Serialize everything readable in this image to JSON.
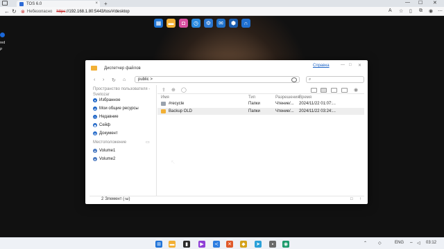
{
  "browser": {
    "tab_title": "TOS 6.0",
    "tab_close": "×",
    "new_tab": "+",
    "minimize": "—",
    "maximize": "☐",
    "close": "✕",
    "back": "←",
    "reload": "↻",
    "insecure_label": "Небезопасно",
    "url_proto": "https",
    "url_rest": "://192.168.1.80:5443/tos/#/desktop"
  },
  "desktop": {
    "left_labels": [
      "red",
      "P"
    ],
    "dock_icons": [
      {
        "name": "app-center-icon",
        "color": "#1e73d2",
        "glyph": "▦"
      },
      {
        "name": "file-manager-icon",
        "color": "#f2b035",
        "glyph": "▬"
      },
      {
        "name": "picture-icon",
        "color": "#d94fa0",
        "glyph": "◘"
      },
      {
        "name": "clock-icon",
        "color": "#2a8be0",
        "glyph": "◷"
      },
      {
        "name": "settings-icon",
        "color": "#2b77d0",
        "glyph": "⚙"
      },
      {
        "name": "mail-icon",
        "color": "#1f70c8",
        "glyph": "✉"
      },
      {
        "name": "box-icon",
        "color": "#1a5db0",
        "glyph": "⬢"
      },
      {
        "name": "headset-icon",
        "color": "#1f6fd0",
        "glyph": "∩"
      }
    ]
  },
  "file_manager": {
    "title": "Диспетчер файлов",
    "help_link": "Справка",
    "path": "public >",
    "sidebar": {
      "storage_heading": "Пространство пользователя - Svetozar",
      "items": [
        {
          "label": "Избранное",
          "icon": "heart-icon"
        },
        {
          "label": "Мои общие ресурсы",
          "icon": "share-icon"
        },
        {
          "label": "Недавние",
          "icon": "clock-icon"
        },
        {
          "label": "Сейф",
          "icon": "safe-icon"
        },
        {
          "label": "Документ",
          "icon": "document-icon"
        }
      ],
      "location_heading": "Местоположение",
      "volumes": [
        {
          "label": "Volume1",
          "icon": "disk-icon"
        },
        {
          "label": "Volume2",
          "icon": "disk-icon"
        }
      ]
    },
    "columns": {
      "name": "Имя",
      "type": "Тип",
      "permissions": "Разрешения",
      "time": "Время"
    },
    "rows": [
      {
        "name": "#recycle",
        "type": "Папки",
        "permissions": "Чтение/...",
        "time": "2024/11/22 01:07:...",
        "icon": "trash-icon"
      },
      {
        "name": "Backup OLD",
        "type": "Папки",
        "permissions": "Чтение/...",
        "time": "2024/11/22 03:24:...",
        "icon": "folder-icon"
      }
    ],
    "status": "2 Элемент (-ы)"
  },
  "taskbar": {
    "lang": "ENG",
    "time": "03:12"
  }
}
